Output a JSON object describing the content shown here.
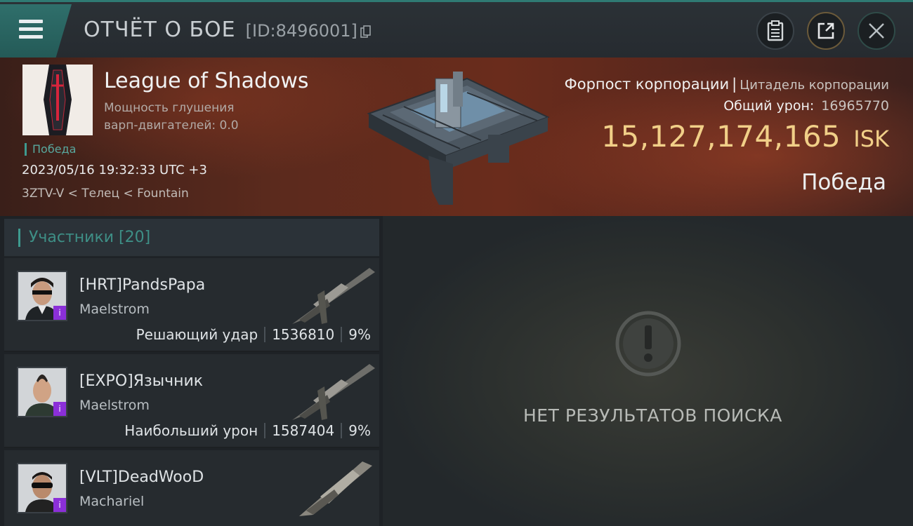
{
  "header": {
    "title": "ОТЧЁТ О БОЕ",
    "report_id": "[ID:8496001]"
  },
  "banner": {
    "corporation_name": "League of Shadows",
    "warp_scramble_line1": "Мощность глушения",
    "warp_scramble_line2": "варп-двигателей: 0.0",
    "result_tag": "Победа",
    "datetime": "2023/05/16 19:32:33 UTC +3",
    "location": "3ZTV-V < Телец < Fountain",
    "target_type": "Форпост корпорации",
    "target_subtype": "Цитадель корпорации",
    "total_damage_label": "Общий урон:",
    "total_damage_value": "16965770",
    "isk_value": "15,127,174,165",
    "isk_unit": "ISK",
    "outcome": "Победа"
  },
  "participants": {
    "header": "Участники [20]",
    "rows": [
      {
        "pilot": "[HRT]PandsPapa",
        "ship": "Maelstrom",
        "role": "Решающий удар",
        "damage": "1536810",
        "percent": "9%"
      },
      {
        "pilot": "[EXPO]Язычник",
        "ship": "Maelstrom",
        "role": "Наибольший урон",
        "damage": "1587404",
        "percent": "9%"
      },
      {
        "pilot": "[VLT]DeadWooD",
        "ship": "Machariel",
        "role": "",
        "damage": "",
        "percent": ""
      }
    ]
  },
  "results": {
    "empty_text": "НЕТ РЕЗУЛЬТАТОВ ПОИСКА"
  },
  "colors": {
    "accent": "#3e9a8f",
    "isk": "#f1cf88",
    "badge": "#8b2fd8"
  }
}
